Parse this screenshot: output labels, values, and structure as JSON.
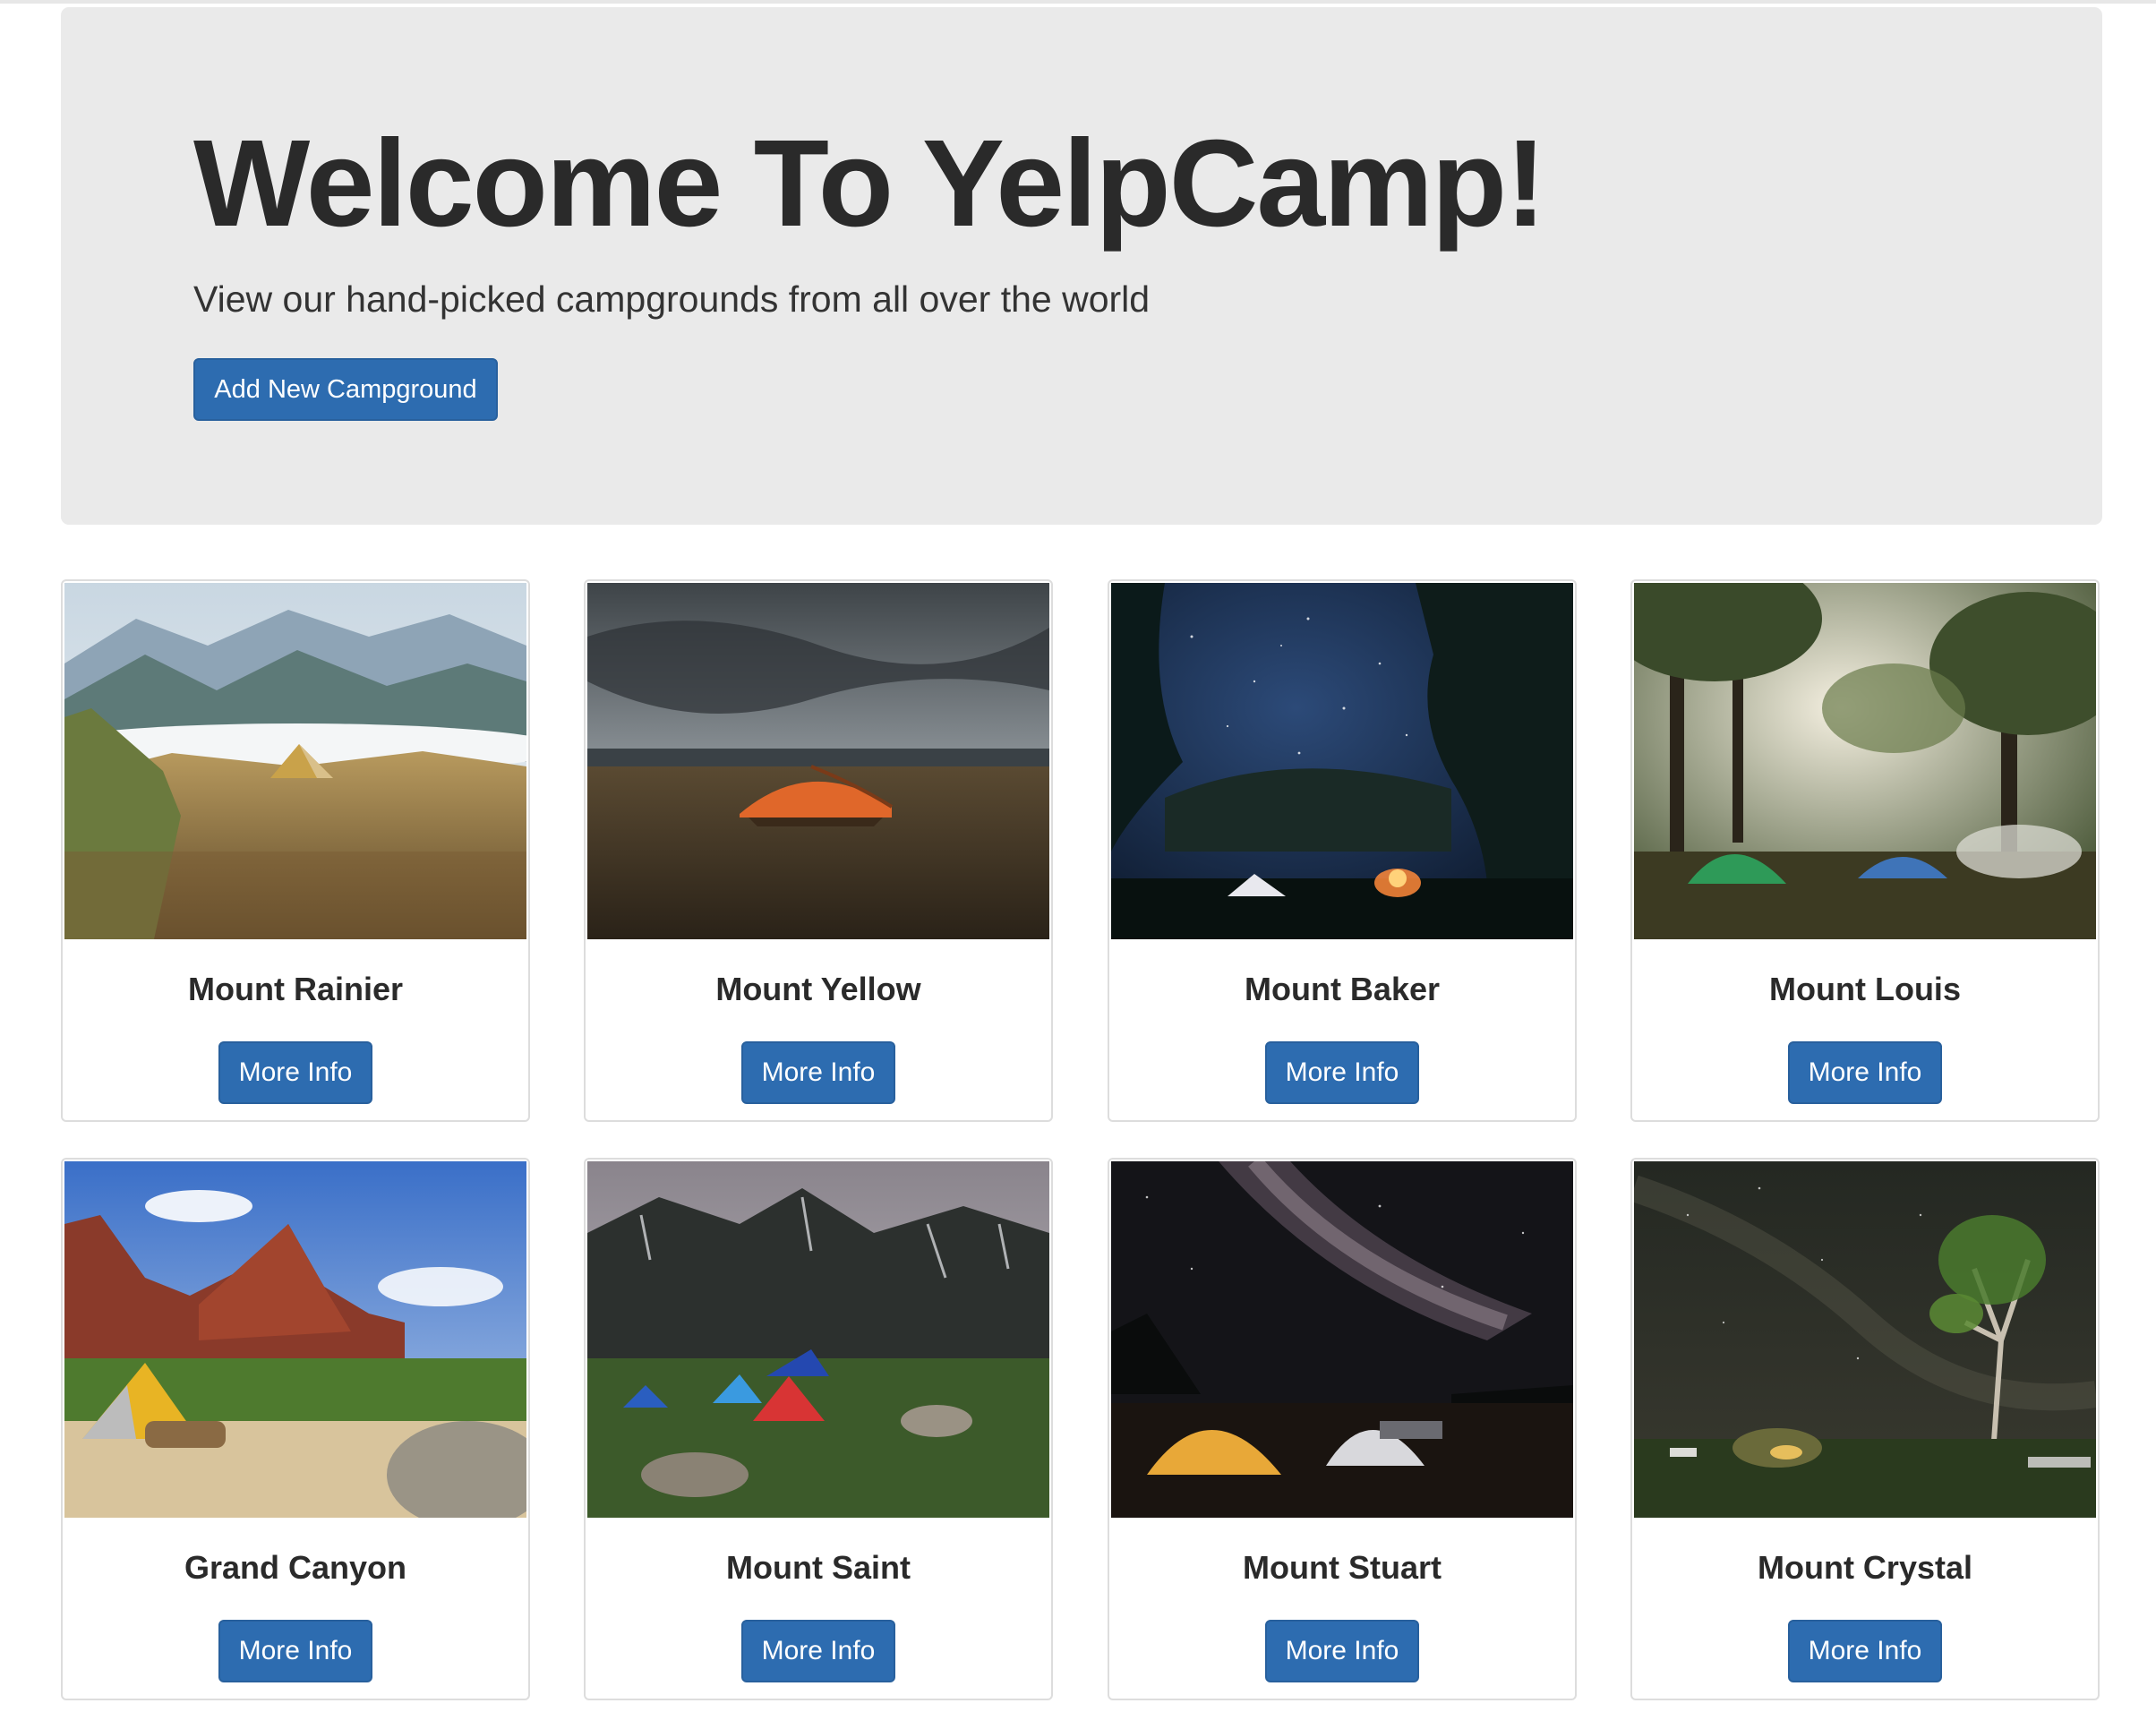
{
  "jumbotron": {
    "title": "Welcome To YelpCamp!",
    "subtitle": "View our hand-picked campgrounds from all over the world",
    "add_button": "Add New Campground"
  },
  "campgrounds": [
    {
      "name": "Mount Rainier",
      "button": "More Info",
      "image": "mountain-tent-clouds"
    },
    {
      "name": "Mount Yellow",
      "button": "More Info",
      "image": "orange-tent-field"
    },
    {
      "name": "Mount Baker",
      "button": "More Info",
      "image": "night-campfire-trees"
    },
    {
      "name": "Mount Louis",
      "button": "More Info",
      "image": "forest-tents-smoke"
    },
    {
      "name": "Grand Canyon",
      "button": "More Info",
      "image": "canyon-yellow-tent"
    },
    {
      "name": "Mount Saint",
      "button": "More Info",
      "image": "snowy-mountains-tents"
    },
    {
      "name": "Mount Stuart",
      "button": "More Info",
      "image": "milky-way-tents"
    },
    {
      "name": "Mount Crystal",
      "button": "More Info",
      "image": "starry-sky-tree"
    }
  ],
  "colors": {
    "primary": "#2d6cb0",
    "jumbotron_bg": "#eaeaea",
    "card_border": "#dddddd"
  }
}
